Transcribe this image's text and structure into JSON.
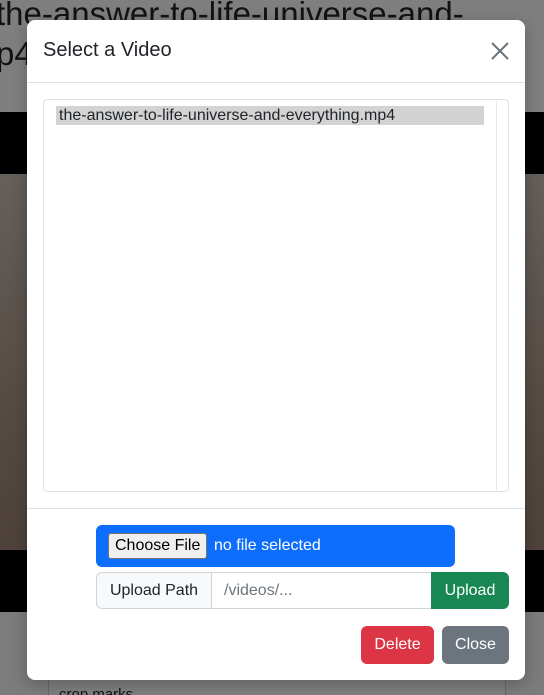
{
  "background": {
    "title_line1": "the-answer-to-life-universe-and-",
    "title_line2": "p4",
    "field_text": "crop marks"
  },
  "modal": {
    "title": "Select a Video",
    "close_icon": "close-x-icon",
    "files": [
      {
        "name": "the-answer-to-life-universe-and-everything.mp4",
        "selected": true
      }
    ],
    "file_input": {
      "button_label": "Choose File",
      "status": "no file selected"
    },
    "upload": {
      "label": "Upload Path",
      "placeholder": "/videos/...",
      "button_label": "Upload"
    },
    "buttons": {
      "delete": "Delete",
      "close": "Close"
    }
  },
  "colors": {
    "primary": "#0d6efd",
    "success": "#198754",
    "danger": "#dc3545",
    "secondary": "#6c757d"
  }
}
